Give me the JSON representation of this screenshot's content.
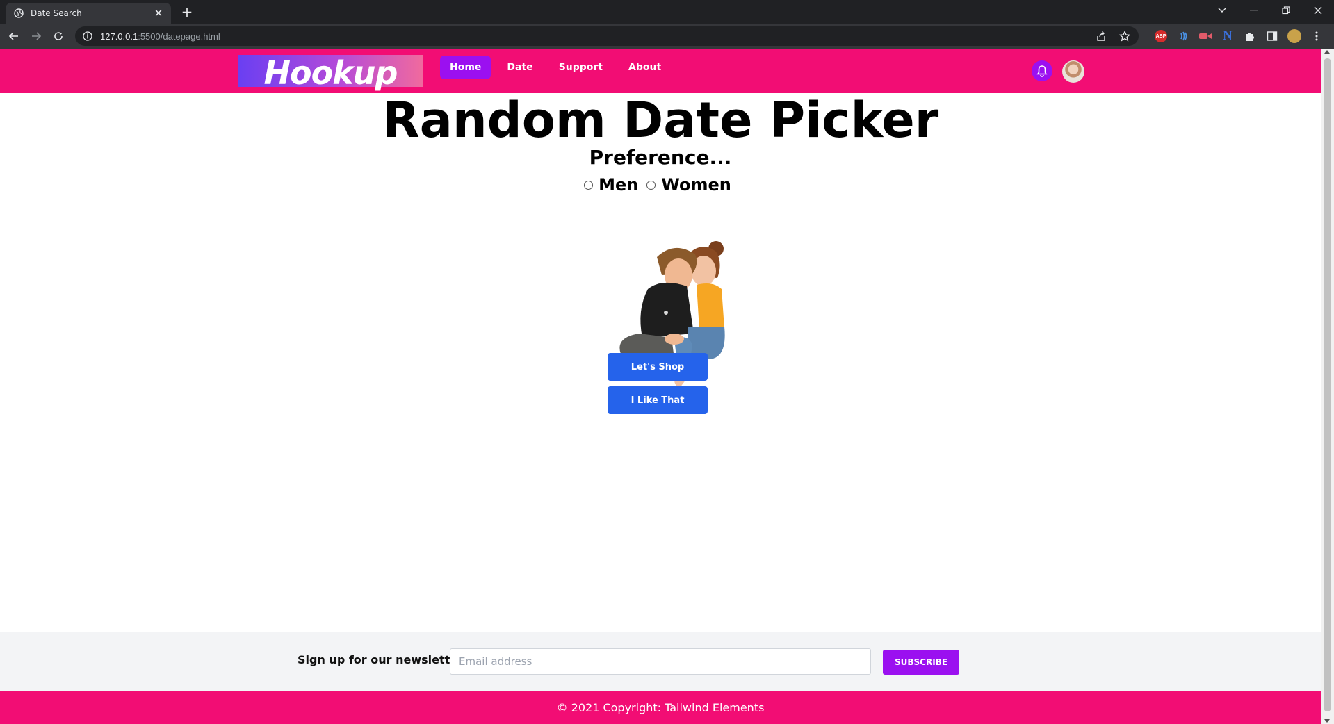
{
  "browser": {
    "tab_title": "Date Search",
    "url_host": "127.0.0.1",
    "url_path": ":5500/datepage.html",
    "icons": [
      "back-icon",
      "forward-icon",
      "reload-icon",
      "info-icon",
      "share-icon",
      "star-icon",
      "adblock-extension",
      "tracker-extension",
      "screen-recorder-extension",
      "n-extension",
      "puzzle-icon",
      "side-panel-icon",
      "profile-avatar",
      "kebab-menu-icon"
    ],
    "extension_abp_label": "ABP",
    "extension_n_label": "N"
  },
  "navbar": {
    "logo": "Hookup",
    "links": [
      "Home",
      "Date",
      "Support",
      "About"
    ],
    "active_link": "Home",
    "colors": {
      "bar": "#f20d74",
      "active": "#9b10f0"
    }
  },
  "main": {
    "title": "Random Date Picker",
    "subtitle": "Preference...",
    "options": [
      "Men",
      "Women"
    ],
    "buttons": [
      "Let's Shop",
      "I Like That"
    ]
  },
  "footer": {
    "newsletter_label": "Sign up for our newsletter!",
    "email_placeholder": "Email address",
    "subscribe_label": "SUBSCRIBE",
    "copyright": "© 2021 Copyright: Tailwind Elements"
  }
}
